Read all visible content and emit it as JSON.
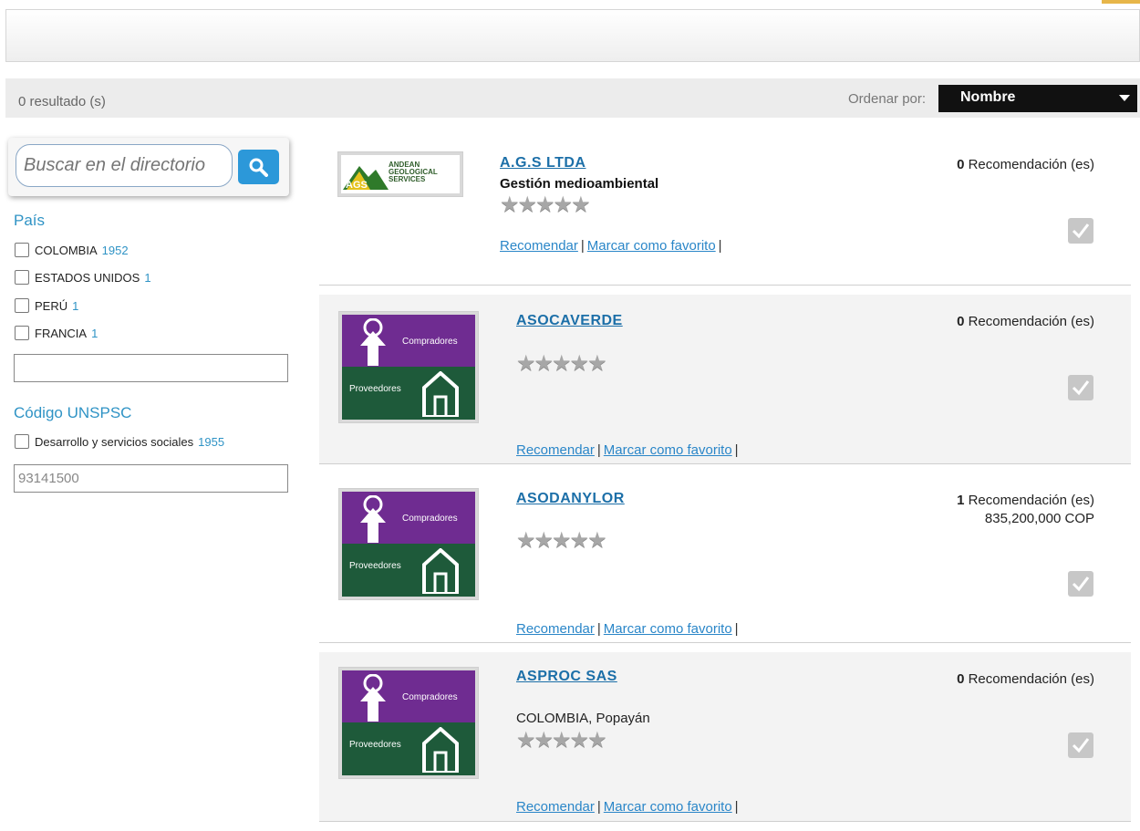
{
  "header": {},
  "results": {
    "count_label": "0 resultado (s)"
  },
  "sort": {
    "label": "Ordenar por:",
    "selected": "Nombre"
  },
  "search": {
    "placeholder": "Buscar en el directorio"
  },
  "filters": {
    "country": {
      "title": "País",
      "options": [
        {
          "label": "COLOMBIA",
          "count": "1952"
        },
        {
          "label": "ESTADOS UNIDOS",
          "count": "1"
        },
        {
          "label": "PERÚ",
          "count": "1"
        },
        {
          "label": "FRANCIA",
          "count": "1"
        }
      ],
      "input_value": ""
    },
    "unspsc": {
      "title": "Código UNSPSC",
      "options": [
        {
          "label": "Desarrollo y servicios sociales",
          "count": "1955"
        }
      ],
      "input_value": "93141500"
    }
  },
  "listings": [
    {
      "name": "A.G.S LTDA",
      "subtitle": "Gestión medioambiental",
      "logo": "ags-logo",
      "logo_text": "ANDEAN GEOLOGICAL SERVICES",
      "logo_mark": "AGS",
      "recommend_count": "0",
      "recommend_label": "Recomendación (es)",
      "rating_stars": "★★★★★",
      "rating": 0,
      "actions": {
        "recommend": "Recomendar",
        "favorite": "Marcar como favorito"
      }
    },
    {
      "name": "ASOCAVERDE",
      "logo": "compradores-proveedores-logo",
      "logo_top": "Compradores",
      "logo_bottom": "Proveedores",
      "recommend_count": "0",
      "recommend_label": "Recomendación (es)",
      "rating_stars": "★★★★★",
      "rating": 0,
      "actions": {
        "recommend": "Recomendar",
        "favorite": "Marcar como favorito"
      }
    },
    {
      "name": "ASODANYLOR",
      "logo": "compradores-proveedores-logo",
      "logo_top": "Compradores",
      "logo_bottom": "Proveedores",
      "recommend_count": "1",
      "recommend_label": "Recomendación (es)",
      "amount": "835,200,000 COP",
      "rating_stars": "★★★★★",
      "rating": 0,
      "actions": {
        "recommend": "Recomendar",
        "favorite": "Marcar como favorito"
      }
    },
    {
      "name": "ASPROC SAS",
      "location": "COLOMBIA, Popayán",
      "logo": "compradores-proveedores-logo",
      "logo_top": "Compradores",
      "logo_bottom": "Proveedores",
      "recommend_count": "0",
      "recommend_label": "Recomendación (es)",
      "rating_stars": "★★★★★",
      "rating": 0,
      "actions": {
        "recommend": "Recomendar",
        "favorite": "Marcar como favorito"
      }
    }
  ],
  "separator": "|",
  "colors": {
    "link": "#1c6fa8",
    "facet_accent": "#2f93c5",
    "search_button": "#2c98d9",
    "sort_bg": "#111111",
    "logo_purple": "#6f2c91",
    "logo_green": "#1e5a3a"
  }
}
